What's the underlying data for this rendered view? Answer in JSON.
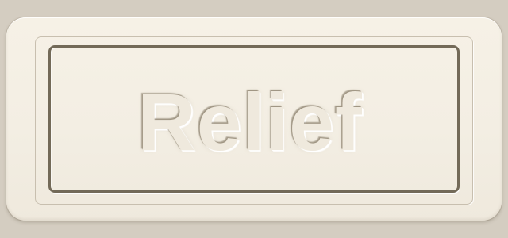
{
  "plaque": {
    "text": "Relief"
  },
  "colors": {
    "background": "#d4cdc1",
    "plate": "#f3eee3",
    "frame_line": "#736a58",
    "outer_line": "#c8bfaf"
  }
}
